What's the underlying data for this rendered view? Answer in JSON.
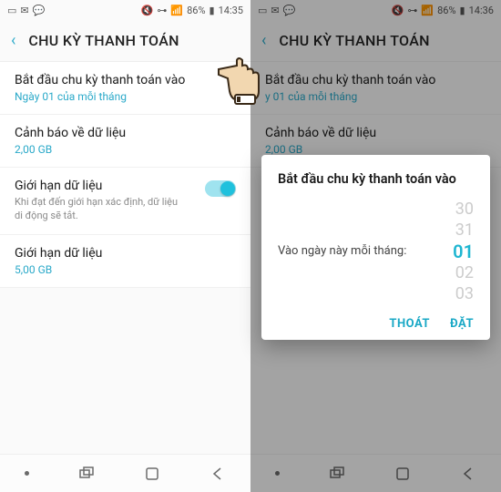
{
  "status": {
    "mute_icon": "🔇",
    "signal": "📶",
    "battery_pct": "86%",
    "time_left": "14:35",
    "time_right": "14:36"
  },
  "header": {
    "title": "CHU KỲ THANH TOÁN"
  },
  "rows": {
    "billing": {
      "primary": "Bắt đầu chu kỳ thanh toán vào",
      "secondary": "Ngày 01 của mỗi tháng"
    },
    "warning": {
      "primary": "Cảnh báo về dữ liệu",
      "secondary": "2,00 GB"
    },
    "limit_toggle": {
      "primary": "Giới hạn dữ liệu",
      "desc": "Khi đạt đến giới hạn xác định, dữ liệu di động sẽ tắt."
    },
    "limit_value": {
      "primary": "Giới hạn dữ liệu",
      "secondary": "5,00 GB"
    }
  },
  "right_rows": {
    "billing_secondary": "y 01 của mỗi tháng"
  },
  "dialog": {
    "title": "Bắt đầu chu kỳ thanh toán vào",
    "label": "Vào ngày này mỗi tháng:",
    "wheel": [
      "30",
      "31",
      "01",
      "02",
      "03"
    ],
    "selected_index": 2,
    "cancel": "THOÁT",
    "ok": "ĐẶT"
  },
  "nav": {
    "recents": "⌁",
    "home": "▭",
    "back": "←"
  }
}
